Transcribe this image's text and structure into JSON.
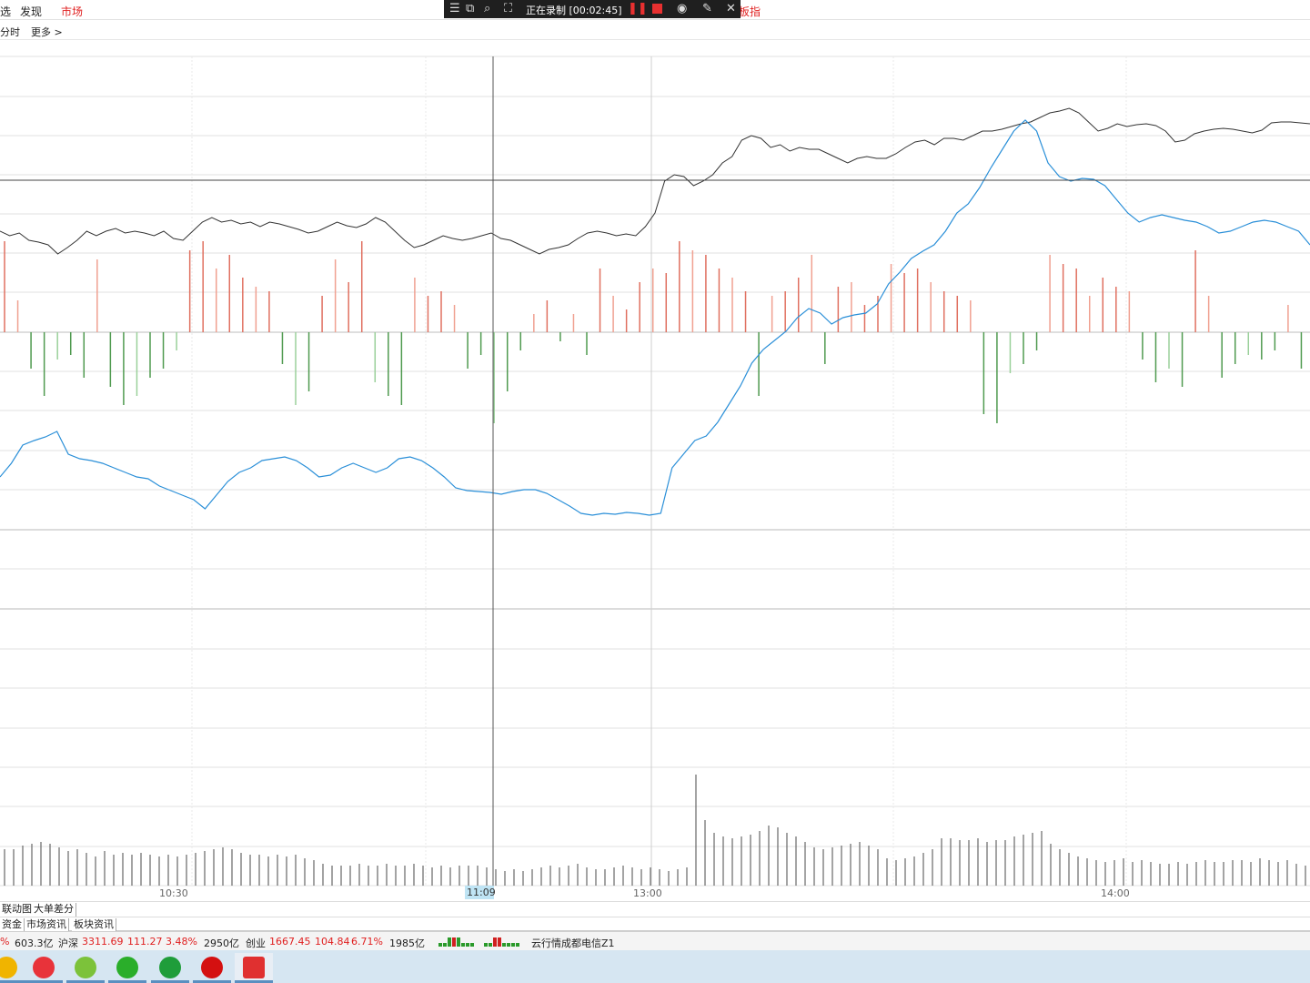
{
  "top_nav": {
    "left_cut": "选",
    "discover": "发现",
    "market": "市场",
    "right_cut": "板指"
  },
  "recorder": {
    "label": "正在录制 [00:02:45]",
    "icons": [
      "menu-icon",
      "window-icon",
      "region-icon",
      "crop-icon",
      "pause-icon",
      "stop-icon",
      "camera-icon",
      "pen-icon",
      "close-icon"
    ]
  },
  "sub_nav": {
    "mode": "分时",
    "more": "更多 >"
  },
  "chart_data": {
    "type": "line",
    "time_labels": {
      "t1030": "10:30",
      "cursor": "11:09",
      "t1300": "13:00",
      "t1400": "14:00"
    },
    "black_line_y": [
      210,
      215,
      212,
      220,
      222,
      225,
      235,
      228,
      220,
      210,
      215,
      210,
      207,
      212,
      210,
      212,
      215,
      210,
      218,
      220,
      210,
      200,
      195,
      200,
      198,
      202,
      200,
      205,
      200,
      202,
      205,
      208,
      212,
      210,
      205,
      200,
      204,
      206,
      202,
      195,
      200,
      210,
      220,
      228,
      225,
      220,
      215,
      218,
      220,
      218,
      215,
      212,
      218,
      220,
      225,
      230,
      235,
      230,
      228,
      225,
      218,
      212,
      210,
      212,
      215,
      213,
      215,
      205,
      190,
      155,
      148,
      150,
      160,
      155,
      148,
      135,
      128,
      110,
      105,
      108,
      118,
      115,
      122,
      118,
      120,
      120,
      125,
      130,
      135,
      130,
      128,
      130,
      130,
      125,
      118,
      112,
      110,
      115,
      108,
      108,
      110,
      105,
      100,
      100,
      98,
      95,
      92,
      90,
      85,
      80,
      78,
      75,
      80,
      90,
      100,
      97,
      92,
      95,
      93,
      92,
      94,
      100,
      112,
      110,
      103,
      100,
      98,
      97,
      98,
      100,
      102,
      99,
      91,
      90,
      90,
      91,
      92
    ],
    "blue_line_y": [
      480,
      465,
      445,
      440,
      436,
      430,
      455,
      460,
      462,
      465,
      470,
      475,
      480,
      482,
      490,
      495,
      500,
      505,
      515,
      500,
      485,
      475,
      470,
      462,
      460,
      458,
      462,
      470,
      480,
      478,
      470,
      465,
      470,
      475,
      470,
      460,
      458,
      462,
      470,
      480,
      492,
      495,
      496,
      497,
      499,
      496,
      494,
      494,
      498,
      505,
      512,
      520,
      522,
      520,
      521,
      519,
      520,
      522,
      520,
      470,
      455,
      440,
      435,
      420,
      400,
      380,
      355,
      340,
      330,
      320,
      305,
      295,
      300,
      312,
      305,
      302,
      300,
      290,
      268,
      255,
      240,
      232,
      225,
      210,
      190,
      180,
      162,
      140,
      120,
      100,
      88,
      100,
      135,
      150,
      155,
      152,
      153,
      160,
      175,
      190,
      200,
      195,
      192,
      195,
      198,
      200,
      205,
      212,
      210,
      205,
      200,
      198,
      200,
      205,
      210,
      225
    ],
    "flow_bars": [
      100,
      35,
      -40,
      -70,
      -30,
      -25,
      -50,
      80,
      -60,
      -80,
      -70,
      -50,
      -40,
      -20,
      90,
      100,
      70,
      85,
      60,
      50,
      45,
      -35,
      -80,
      -65,
      40,
      80,
      55,
      100,
      -55,
      -70,
      -80,
      60,
      40,
      45,
      30,
      -40,
      -25,
      -100,
      -65,
      -20,
      20,
      35,
      -10,
      20,
      -25,
      70,
      40,
      25,
      55,
      70,
      65,
      100,
      90,
      85,
      70,
      60,
      45,
      -70,
      40,
      45,
      60,
      85,
      -35,
      50,
      55,
      30,
      40,
      75,
      65,
      70,
      55,
      45,
      40,
      35,
      -90,
      -100,
      -45,
      -35,
      -20,
      85,
      75,
      70,
      40,
      60,
      50,
      45,
      -30,
      -55,
      -40,
      -60,
      90,
      40,
      -50,
      -35,
      -25,
      -30,
      -20,
      30,
      -40
    ],
    "volume_bars": [
      40,
      40,
      44,
      46,
      48,
      46,
      42,
      38,
      40,
      36,
      32,
      38,
      34,
      36,
      34,
      36,
      34,
      32,
      34,
      32,
      34,
      36,
      38,
      40,
      42,
      40,
      36,
      34,
      34,
      32,
      34,
      32,
      34,
      30,
      28,
      24,
      22,
      22,
      22,
      24,
      22,
      22,
      24,
      22,
      22,
      24,
      22,
      20,
      22,
      20,
      22,
      22,
      22,
      20,
      18,
      16,
      18,
      16,
      18,
      20,
      22,
      20,
      22,
      24,
      20,
      18,
      18,
      20,
      22,
      20,
      18,
      20,
      18,
      16,
      18,
      20,
      122,
      72,
      58,
      54,
      52,
      54,
      56,
      60,
      66,
      64,
      58,
      54,
      48,
      42,
      40,
      42,
      44,
      46,
      48,
      44,
      40,
      30,
      28,
      30,
      32,
      36,
      40,
      52,
      52,
      50,
      50,
      52,
      48,
      50,
      50,
      54,
      56,
      58,
      60,
      46,
      40,
      36,
      32,
      30,
      28,
      26,
      28,
      30,
      26,
      28,
      26,
      24,
      24,
      26,
      24,
      26,
      28,
      26,
      26,
      28,
      28,
      26,
      30,
      28,
      26,
      28,
      24,
      22
    ]
  },
  "tabs_row1": [
    "联动图",
    "大单差分"
  ],
  "tabs_row2": [
    "资金",
    "市场资讯",
    "板块资讯"
  ],
  "status": {
    "cut_pct": "%",
    "amount1": "603.3亿",
    "hushen_label": "沪深",
    "hushen_value": "3311.69",
    "hushen_change": "111.27",
    "hushen_pct": "3.48%",
    "hushen_amount": "2950亿",
    "cyb_label": "创业",
    "cyb_value": "1667.45",
    "cyb_change": "104.84",
    "cyb_pct": "6.71%",
    "cyb_amount": "1985亿",
    "news": "云行情成都电信Z1"
  },
  "taskbar": {
    "apps": [
      "folder-icon",
      "heart-app-icon",
      "music-app-icon",
      "wechat-icon",
      "evernote-icon",
      "record-icon",
      "stock-app-icon"
    ],
    "colors": [
      "#f0b400",
      "#e8333a",
      "#7cc23a",
      "#2aae2a",
      "#1f9d3a",
      "#d41010",
      "#e03030"
    ]
  }
}
